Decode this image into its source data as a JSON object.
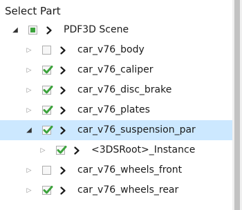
{
  "panel": {
    "title": "Select Part"
  },
  "tree": {
    "items": [
      {
        "label": "PDF3D Scene",
        "depth": 0,
        "expander": "expanded",
        "check": "partial",
        "selected": false
      },
      {
        "label": "car_v76_body",
        "depth": 1,
        "expander": "collapsed",
        "check": "unchecked",
        "selected": false
      },
      {
        "label": "car_v76_caliper",
        "depth": 1,
        "expander": "collapsed",
        "check": "checked",
        "selected": false
      },
      {
        "label": "car_v76_disc_brake",
        "depth": 1,
        "expander": "collapsed",
        "check": "checked",
        "selected": false
      },
      {
        "label": "car_v76_plates",
        "depth": 1,
        "expander": "collapsed",
        "check": "checked",
        "selected": false
      },
      {
        "label": "car_v76_suspension_par",
        "depth": 1,
        "expander": "expanded",
        "check": "checked",
        "selected": true
      },
      {
        "label": "<3DSRoot>_Instance",
        "depth": 2,
        "expander": "collapsed",
        "check": "checked",
        "selected": false
      },
      {
        "label": "car_v76_wheels_front",
        "depth": 1,
        "expander": "collapsed",
        "check": "unchecked",
        "selected": false
      },
      {
        "label": "car_v76_wheels_rear",
        "depth": 1,
        "expander": "collapsed",
        "check": "checked",
        "selected": false
      }
    ]
  },
  "icons": {
    "expanded": "expanded-triangle-icon",
    "collapsed": "collapsed-triangle-icon",
    "node": "chevron-right-icon",
    "checked": "checkmark-icon"
  },
  "colors": {
    "selected_row": "#cce8ff",
    "check_green": "#3ca33c",
    "partial_fill": "#3ca33c"
  }
}
